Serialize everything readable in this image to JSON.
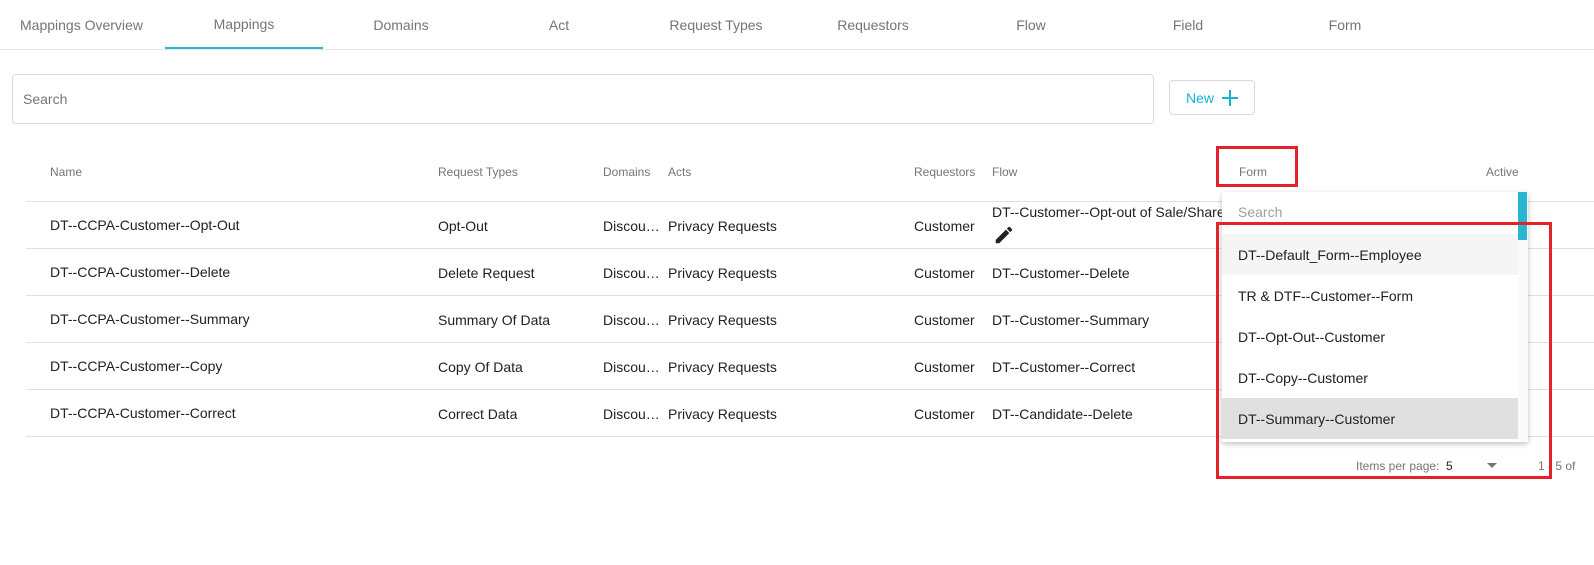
{
  "tabs": [
    {
      "label": "Mappings Overview"
    },
    {
      "label": "Mappings"
    },
    {
      "label": "Domains"
    },
    {
      "label": "Act"
    },
    {
      "label": "Request Types"
    },
    {
      "label": "Requestors"
    },
    {
      "label": "Flow"
    },
    {
      "label": "Field"
    },
    {
      "label": "Form"
    }
  ],
  "active_tab": "Mappings",
  "search": {
    "placeholder": "Search"
  },
  "new_button": {
    "label": "New",
    "icon": "plus-icon"
  },
  "table": {
    "headers": {
      "name": "Name",
      "request_types": "Request Types",
      "domains": "Domains",
      "acts": "Acts",
      "requestors": "Requestors",
      "flow": "Flow",
      "form": "Form",
      "active": "Active"
    },
    "rows": [
      {
        "name": "DT--CCPA-Customer--Opt-Out",
        "request_type": "Opt-Out",
        "domain": "Discount Tire",
        "act": "Privacy Requests",
        "requestor": "Customer",
        "flow": "DT--Customer--Opt-out of Sale/Share"
      },
      {
        "name": "DT--CCPA-Customer--Delete",
        "request_type": "Delete Request",
        "domain": "Discount Tire",
        "act": "Privacy Requests",
        "requestor": "Customer",
        "flow": "DT--Customer--Delete"
      },
      {
        "name": "DT--CCPA-Customer--Summary",
        "request_type": "Summary Of Data",
        "domain": "Discount Tire",
        "act": "Privacy Requests",
        "requestor": "Customer",
        "flow": "DT--Customer--Summary"
      },
      {
        "name": "DT--CCPA-Customer--Copy",
        "request_type": "Copy Of Data",
        "domain": "Discount Tire",
        "act": "Privacy Requests",
        "requestor": "Customer",
        "flow": "DT--Customer--Correct"
      },
      {
        "name": "DT--CCPA-Customer--Correct",
        "request_type": "Correct Data",
        "domain": "Discount Tire",
        "act": "Privacy Requests",
        "requestor": "Customer",
        "flow": "DT--Candidate--Delete"
      }
    ]
  },
  "form_dropdown": {
    "search_placeholder": "Search",
    "options": [
      "DT--Default_Form--Employee",
      "TR & DTF--Customer--Form",
      "DT--Opt-Out--Customer",
      "DT--Copy--Customer",
      "DT--Summary--Customer"
    ],
    "highlighted_index": 4
  },
  "pagination": {
    "items_per_page_label": "Items per page:",
    "items_per_page_value": "5",
    "range": "1 - 5 of"
  },
  "colors": {
    "accent": "#26b6cf",
    "highlight_red": "#e3232a"
  }
}
